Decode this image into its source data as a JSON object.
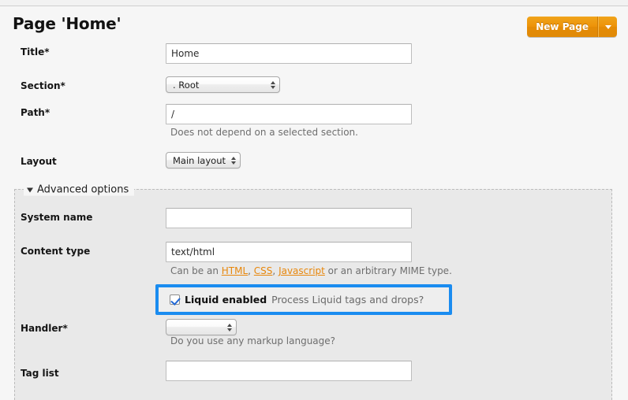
{
  "header": {
    "title": "Page 'Home'",
    "new_page_button": "New Page",
    "new_page_dropdown_icon": "chevron-down-icon"
  },
  "form": {
    "title_field": {
      "label": "Title*",
      "value": "Home"
    },
    "section_field": {
      "label": "Section*",
      "value": ". Root",
      "stepper_icon": "updown-stepper-icon"
    },
    "path_field": {
      "label": "Path*",
      "value": "/",
      "hint": "Does not depend on a selected section."
    },
    "layout_field": {
      "label": "Layout",
      "value": "Main layout",
      "stepper_icon": "updown-stepper-icon"
    }
  },
  "advanced": {
    "legend": "Advanced options",
    "toggle_icon": "triangle-down-icon",
    "system_name_field": {
      "label": "System name",
      "value": ""
    },
    "content_type_field": {
      "label": "Content type",
      "value": "text/html",
      "hint_prefix": "Can be an ",
      "link_html": "HTML",
      "sep1": ", ",
      "link_css": "CSS",
      "sep2": ", ",
      "link_js": "Javascript",
      "hint_suffix": " or an arbitrary MIME type."
    },
    "liquid_checkbox": {
      "checked": true,
      "label": "Liquid enabled",
      "hint": "Process Liquid tags and drops?",
      "highlight_color": "#1a8cf0"
    },
    "handler_field": {
      "label": "Handler*",
      "value": "",
      "hint": "Do you use any markup language?",
      "stepper_icon": "updown-stepper-icon"
    },
    "tag_list_field": {
      "label": "Tag list",
      "value": ""
    }
  },
  "colors": {
    "accent_orange": "#ed9208",
    "link_orange": "#e8870c",
    "highlight_blue": "#1a8cf0",
    "page_bg": "#f6f6f6",
    "panel_bg": "#e9e9e9"
  }
}
